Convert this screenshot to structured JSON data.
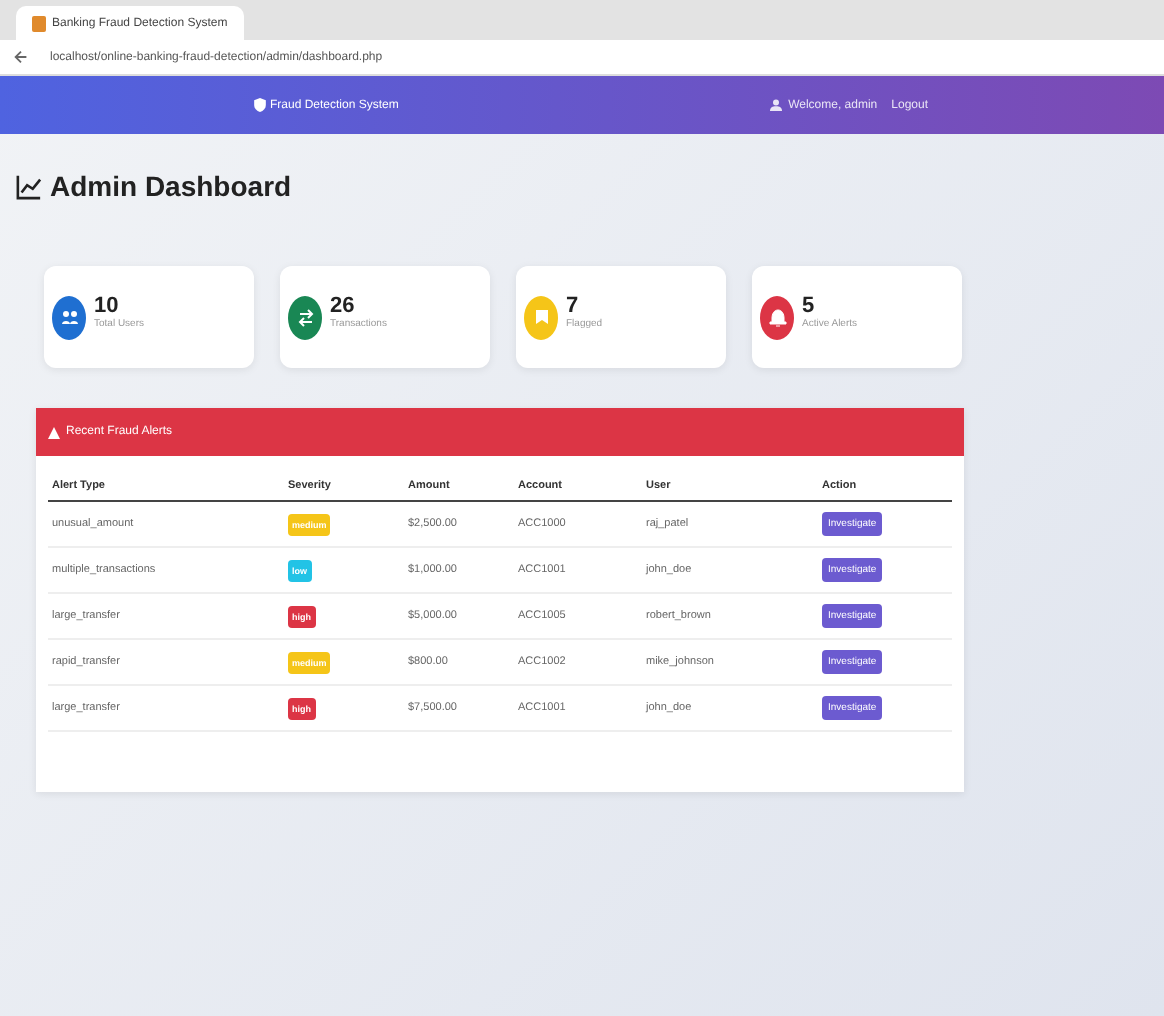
{
  "browser": {
    "tab_title": "Banking Fraud Detection System",
    "url": "localhost/online-banking-fraud-detection/admin/dashboard.php"
  },
  "navbar": {
    "brand": "Fraud Detection System",
    "welcome": "Welcome, admin",
    "logout": "Logout"
  },
  "page_title": "Admin Dashboard",
  "stats": [
    {
      "value": "10",
      "label": "Total Users",
      "color": "#1f6fd1",
      "kind": "users"
    },
    {
      "value": "26",
      "label": "Transactions",
      "color": "#198754",
      "kind": "transfers"
    },
    {
      "value": "7",
      "label": "Flagged",
      "color": "#f5c518",
      "kind": "flagged"
    },
    {
      "value": "5",
      "label": "Active Alerts",
      "color": "#dc3545",
      "kind": "alerts"
    }
  ],
  "alerts": {
    "title": "Recent Fraud Alerts",
    "columns": [
      "Alert Type",
      "Severity",
      "Amount",
      "Account",
      "User",
      "Action"
    ],
    "rows": [
      {
        "type": "unusual_amount",
        "severity": "medium",
        "color": "#f5c518",
        "amount": "$2,500.00",
        "account": "ACC1000",
        "user": "raj_patel",
        "action": "Investigate"
      },
      {
        "type": "multiple_transactions",
        "severity": "low",
        "color": "#22c3e6",
        "amount": "$1,000.00",
        "account": "ACC1001",
        "user": "john_doe",
        "action": "Investigate"
      },
      {
        "type": "large_transfer",
        "severity": "high",
        "color": "#dc3545",
        "amount": "$5,000.00",
        "account": "ACC1005",
        "user": "robert_brown",
        "action": "Investigate"
      },
      {
        "type": "rapid_transfer",
        "severity": "medium",
        "color": "#f5c518",
        "amount": "$800.00",
        "account": "ACC1002",
        "user": "mike_johnson",
        "action": "Investigate"
      },
      {
        "type": "large_transfer",
        "severity": "high",
        "color": "#dc3545",
        "amount": "$7,500.00",
        "account": "ACC1001",
        "user": "john_doe",
        "action": "Investigate"
      }
    ]
  }
}
